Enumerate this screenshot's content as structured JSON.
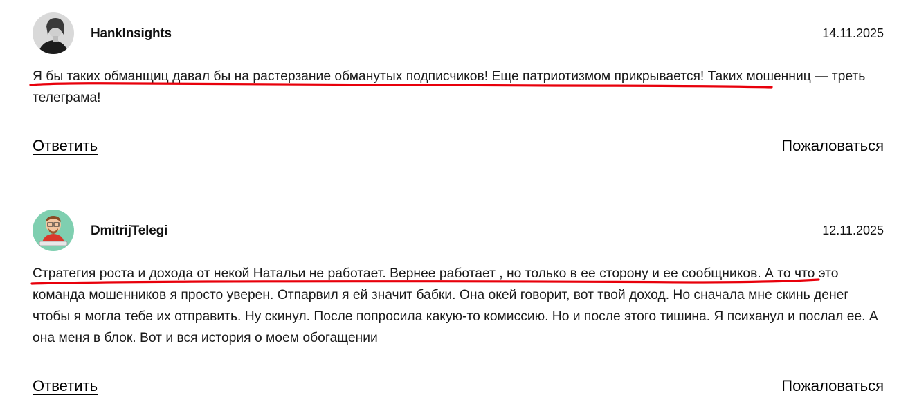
{
  "comments": [
    {
      "author": "HankInsights",
      "date": "14.11.2025",
      "avatar_icon": "user-photo-avatar",
      "text": "Я бы таких обманщиц давал бы на растерзание обманутых подписчиков! Еще патриотизмом прикрывается! Таких мошенниц — треть телеграма!",
      "reply_label": "Ответить",
      "report_label": "Пожаловаться"
    },
    {
      "author": "DmitrijTelegi",
      "date": "12.11.2025",
      "avatar_icon": "cartoon-avatar",
      "text": "Стратегия роста и дохода от некой Натальи не работает. Вернее работает , но только в ее сторону и ее сообщников. А то что это команда мошенников я просто уверен. Отпарвил я ей значит бабки. Она окей говорит, вот твой доход. Но сначала мне скинь денег чтобы я могла тебе их отправить. Ну скинул. После попросила какую-то комиссию. Но и после этого тишина. Я психанул и послал ее. А она меня в блок. Вот и вся история о моем обогащении",
      "reply_label": "Ответить",
      "report_label": "Пожаловаться"
    }
  ],
  "colors": {
    "highlight": "#e8000b",
    "divider": "#dddddd"
  }
}
